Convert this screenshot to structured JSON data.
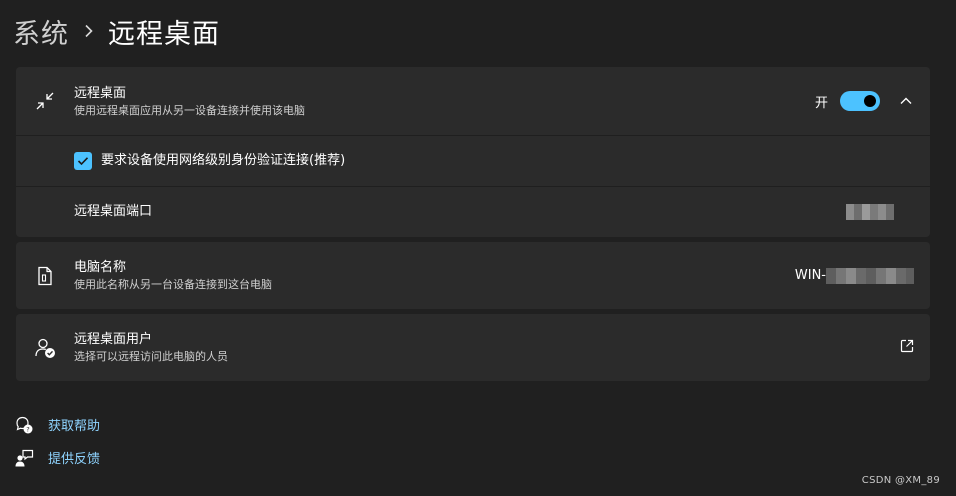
{
  "breadcrumb": {
    "parent": "系统",
    "current": "远程桌面"
  },
  "colors": {
    "accent": "#4cc2ff",
    "card": "#2b2b2b",
    "background": "#202020",
    "link": "#8fd4ff"
  },
  "remote_desktop": {
    "title": "远程桌面",
    "subtitle": "使用远程桌面应用从另一设备连接并使用该电脑",
    "state_label": "开",
    "enabled": true,
    "expanded": true,
    "nla_label": "要求设备使用网络级别身份验证连接(推荐)",
    "nla_checked": true,
    "port_label": "远程桌面端口",
    "port_value_redacted": true
  },
  "pc_name": {
    "title": "电脑名称",
    "subtitle": "使用此名称从另一台设备连接到这台电脑",
    "value_prefix": "WIN-"
  },
  "users": {
    "title": "远程桌面用户",
    "subtitle": "选择可以远程访问此电脑的人员"
  },
  "links": {
    "help": "获取帮助",
    "feedback": "提供反馈"
  },
  "watermark": "CSDN @XM_89"
}
